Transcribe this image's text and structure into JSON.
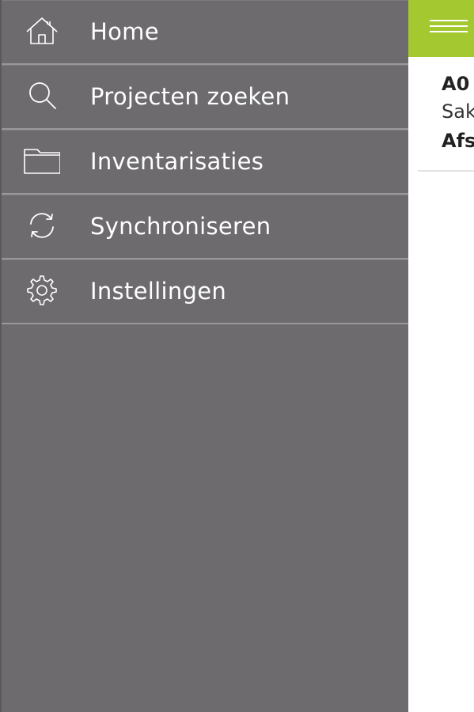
{
  "drawer": {
    "items": [
      {
        "label": "Home",
        "icon": "home-icon"
      },
      {
        "label": "Projecten zoeken",
        "icon": "search-icon"
      },
      {
        "label": "Inventarisaties",
        "icon": "folder-icon"
      },
      {
        "label": "Synchroniseren",
        "icon": "sync-icon"
      },
      {
        "label": "Instellingen",
        "icon": "gear-icon"
      }
    ]
  },
  "main": {
    "topbar_color": "#a4c82f",
    "menu_icon": "hamburger-menu-icon",
    "project": {
      "code": "A0",
      "name": "Sak",
      "status": "Afs"
    }
  },
  "colors": {
    "drawer_background": "#6d6b6e",
    "accent": "#a4c82f",
    "text_on_drawer": "#ffffff"
  }
}
